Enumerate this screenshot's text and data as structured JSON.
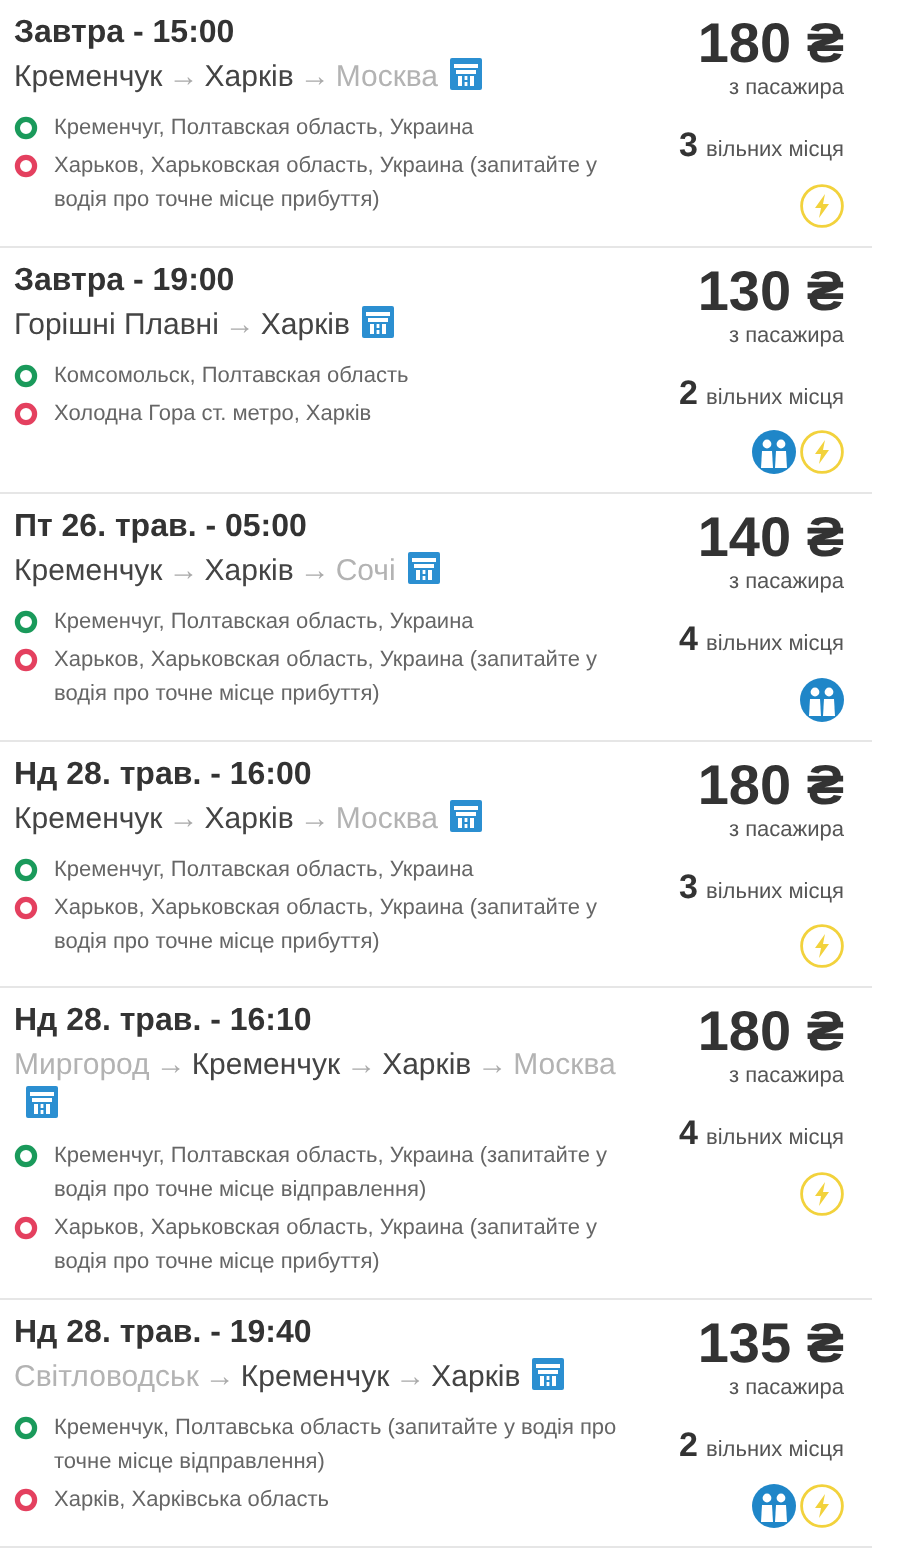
{
  "trips": [
    {
      "date": "Завтра - 15:00",
      "route": [
        {
          "name": "Кременчук",
          "active": true
        },
        {
          "arrow": "→",
          "name": "Харків",
          "active": true
        },
        {
          "arrow": "→",
          "name": "Москва",
          "active": false
        }
      ],
      "stops": [
        {
          "kind": "departure",
          "text": "Кременчуг, Полтавская область, Украина"
        },
        {
          "kind": "arrival",
          "text": "Харьков, Харьковская область, Украина (запитайте у водія про точне місце прибуття)"
        }
      ],
      "price": "180 ₴",
      "price_note": "з пасажира",
      "seats": "3",
      "seats_label": "вільних місця",
      "features": [
        {
          "kind": "instant"
        }
      ]
    },
    {
      "date": "Завтра - 19:00",
      "route": [
        {
          "name": "Горішні Плавні",
          "active": true
        },
        {
          "arrow": "→",
          "name": "Харків",
          "active": true
        }
      ],
      "stops": [
        {
          "kind": "departure",
          "text": "Комсомольск, Полтавская область"
        },
        {
          "kind": "arrival",
          "text": "Холодна Гора ст. метро, Харків"
        }
      ],
      "price": "130 ₴",
      "price_note": "з пасажира",
      "seats": "2",
      "seats_label": "вільних місця",
      "features": [
        {
          "kind": "women"
        },
        {
          "kind": "instant"
        }
      ]
    },
    {
      "date": "Пт 26. трав. - 05:00",
      "route": [
        {
          "name": "Кременчук",
          "active": true
        },
        {
          "arrow": "→",
          "name": "Харків",
          "active": true
        },
        {
          "arrow": "→",
          "name": "Сочі",
          "active": false
        }
      ],
      "stops": [
        {
          "kind": "departure",
          "text": "Кременчуг, Полтавская область, Украина"
        },
        {
          "kind": "arrival",
          "text": "Харьков, Харьковская область, Украина (запитайте у водія про точне місце прибуття)"
        }
      ],
      "price": "140 ₴",
      "price_note": "з пасажира",
      "seats": "4",
      "seats_label": "вільних місця",
      "features": [
        {
          "kind": "women"
        }
      ]
    },
    {
      "date": "Нд 28. трав. - 16:00",
      "route": [
        {
          "name": "Кременчук",
          "active": true
        },
        {
          "arrow": "→",
          "name": "Харків",
          "active": true
        },
        {
          "arrow": "→",
          "name": "Москва",
          "active": false
        }
      ],
      "stops": [
        {
          "kind": "departure",
          "text": "Кременчуг, Полтавская область, Украина"
        },
        {
          "kind": "arrival",
          "text": "Харьков, Харьковская область, Украина (запитайте у водія про точне місце прибуття)"
        }
      ],
      "price": "180 ₴",
      "price_note": "з пасажира",
      "seats": "3",
      "seats_label": "вільних місця",
      "features": [
        {
          "kind": "instant"
        }
      ]
    },
    {
      "date": "Нд 28. трав. - 16:10",
      "route": [
        {
          "name": "Миргород",
          "active": false
        },
        {
          "arrow": "→",
          "name": "Кременчук",
          "active": true
        },
        {
          "arrow": "→",
          "name": "Харків",
          "active": true
        },
        {
          "arrow": "→",
          "name": "Москва",
          "active": false
        }
      ],
      "stops": [
        {
          "kind": "departure",
          "text": "Кременчуг, Полтавская область, Украина (запитайте у водія про точне місце відправлення)"
        },
        {
          "kind": "arrival",
          "text": "Харьков, Харьковская область, Украина (запитайте у водія про точне місце прибуття)"
        }
      ],
      "price": "180 ₴",
      "price_note": "з пасажира",
      "seats": "4",
      "seats_label": "вільних місця",
      "features": [
        {
          "kind": "instant"
        }
      ]
    },
    {
      "date": "Нд 28. трав. - 19:40",
      "route": [
        {
          "name": "Світловодськ",
          "active": false
        },
        {
          "arrow": "→",
          "name": "Кременчук",
          "active": true
        },
        {
          "arrow": "→",
          "name": "Харків",
          "active": true
        }
      ],
      "stops": [
        {
          "kind": "departure",
          "text": "Кременчук, Полтавська область (запитайте у водія про точне місце відправлення)"
        },
        {
          "kind": "arrival",
          "text": "Харків, Харківська область"
        }
      ],
      "price": "135 ₴",
      "price_note": "з пасажира",
      "seats": "2",
      "seats_label": "вільних місця",
      "features": [
        {
          "kind": "women"
        },
        {
          "kind": "instant"
        }
      ]
    }
  ]
}
